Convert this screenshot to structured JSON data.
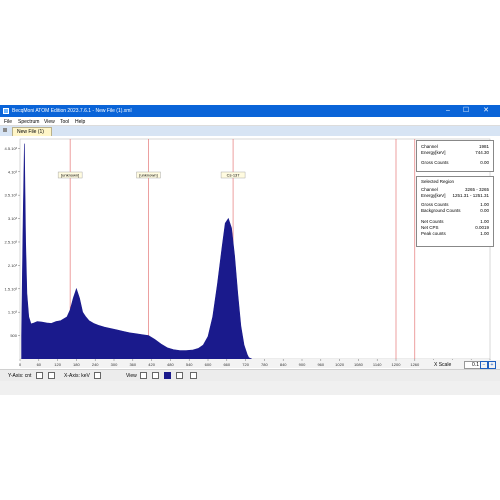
{
  "app": {
    "title": "BecqMoni ATOM Edition 2023.7.6.1 - New File (1).xml",
    "min": "–",
    "max": "☐",
    "close": "✕"
  },
  "menu": [
    "File",
    "Spectrum",
    "View",
    "Tool",
    "Help"
  ],
  "tab": {
    "label": "New File (1)"
  },
  "info_cursor": {
    "channel_label": "Channel",
    "channel_value": "1981",
    "energy_label": "Energy[keV]",
    "energy_value": "744.30",
    "gross_label": "Gross Counts",
    "gross_value": "0.00"
  },
  "info_region": {
    "header": "Selected Region",
    "channel_label": "Channel",
    "channel_value": "3265 - 3265",
    "energy_label": "Energy[keV]",
    "energy_value": "1251.31 - 1251.31",
    "gross_label": "Gross Counts",
    "gross_value": "1.00",
    "background_label": "Background Counts",
    "background_value": "0.00",
    "net_label": "Net Counts",
    "net_value": "1.00",
    "cps_label": "Net CPS",
    "cps_value": "0.0019",
    "peak_label": "Peak counts",
    "peak_value": "1.00"
  },
  "markers": [
    "[unknown]",
    "[unknown]",
    "Cs-137"
  ],
  "toolbar": {
    "yaxis_label": "Y-Axis: cnt",
    "xaxis_label": "X-Axis: keV",
    "view_label": "View"
  },
  "scale": {
    "label": "X Scale",
    "value": "0.1"
  },
  "colors": {
    "spectrum": "#1a1a8c",
    "titlebar": "#0a64d8",
    "marker_line": "#e06060",
    "tab_active": "#fff6c8"
  },
  "chart_data": {
    "type": "area",
    "x_unit": "keV",
    "y_tick_labels": [
      "500",
      "1.10³",
      "1.5.10³",
      "2.10³",
      "2.5.10³",
      "3.10³",
      "3.5.10³",
      "4.10³",
      "4.5.10³"
    ],
    "x_tick_labels": [
      "0",
      "60",
      "120",
      "180",
      "240",
      "300",
      "360",
      "420",
      "480",
      "540",
      "600",
      "660",
      "720",
      "780",
      "840",
      "900",
      "960",
      "1020",
      "1080",
      "1140",
      "1200",
      "1260",
      "1320",
      "1380",
      "1440",
      "1500"
    ],
    "ylim": [
      0,
      4700
    ],
    "xlim": [
      0,
      1500
    ],
    "series": [
      {
        "x": [
          5,
          10,
          14,
          18,
          22,
          28,
          35,
          45,
          55,
          70,
          85,
          100,
          115,
          130,
          150,
          160,
          170,
          180,
          190,
          200,
          210,
          220,
          235,
          250,
          270,
          290,
          310,
          330,
          350,
          370,
          390,
          410,
          430,
          450,
          470,
          490,
          510,
          530,
          550,
          570,
          585,
          600,
          615,
          630,
          645,
          655,
          665,
          675,
          685,
          695,
          705,
          715,
          725,
          730,
          740
        ],
        "y": [
          500,
          3000,
          4600,
          2500,
          1400,
          900,
          750,
          770,
          800,
          790,
          770,
          760,
          800,
          820,
          900,
          1050,
          1300,
          1500,
          1300,
          1000,
          900,
          820,
          760,
          720,
          680,
          650,
          620,
          590,
          560,
          540,
          520,
          500,
          420,
          320,
          240,
          200,
          180,
          180,
          190,
          230,
          300,
          480,
          900,
          1600,
          2400,
          2900,
          3000,
          2800,
          2200,
          1400,
          700,
          300,
          100,
          30,
          0
        ]
      }
    ],
    "marker_x": [
      160,
      410,
      680,
      1200,
      1260
    ],
    "marker_labels": [
      "[unknown]",
      "[unknown]",
      "Cs-137"
    ],
    "grid": false,
    "legend": "none"
  }
}
